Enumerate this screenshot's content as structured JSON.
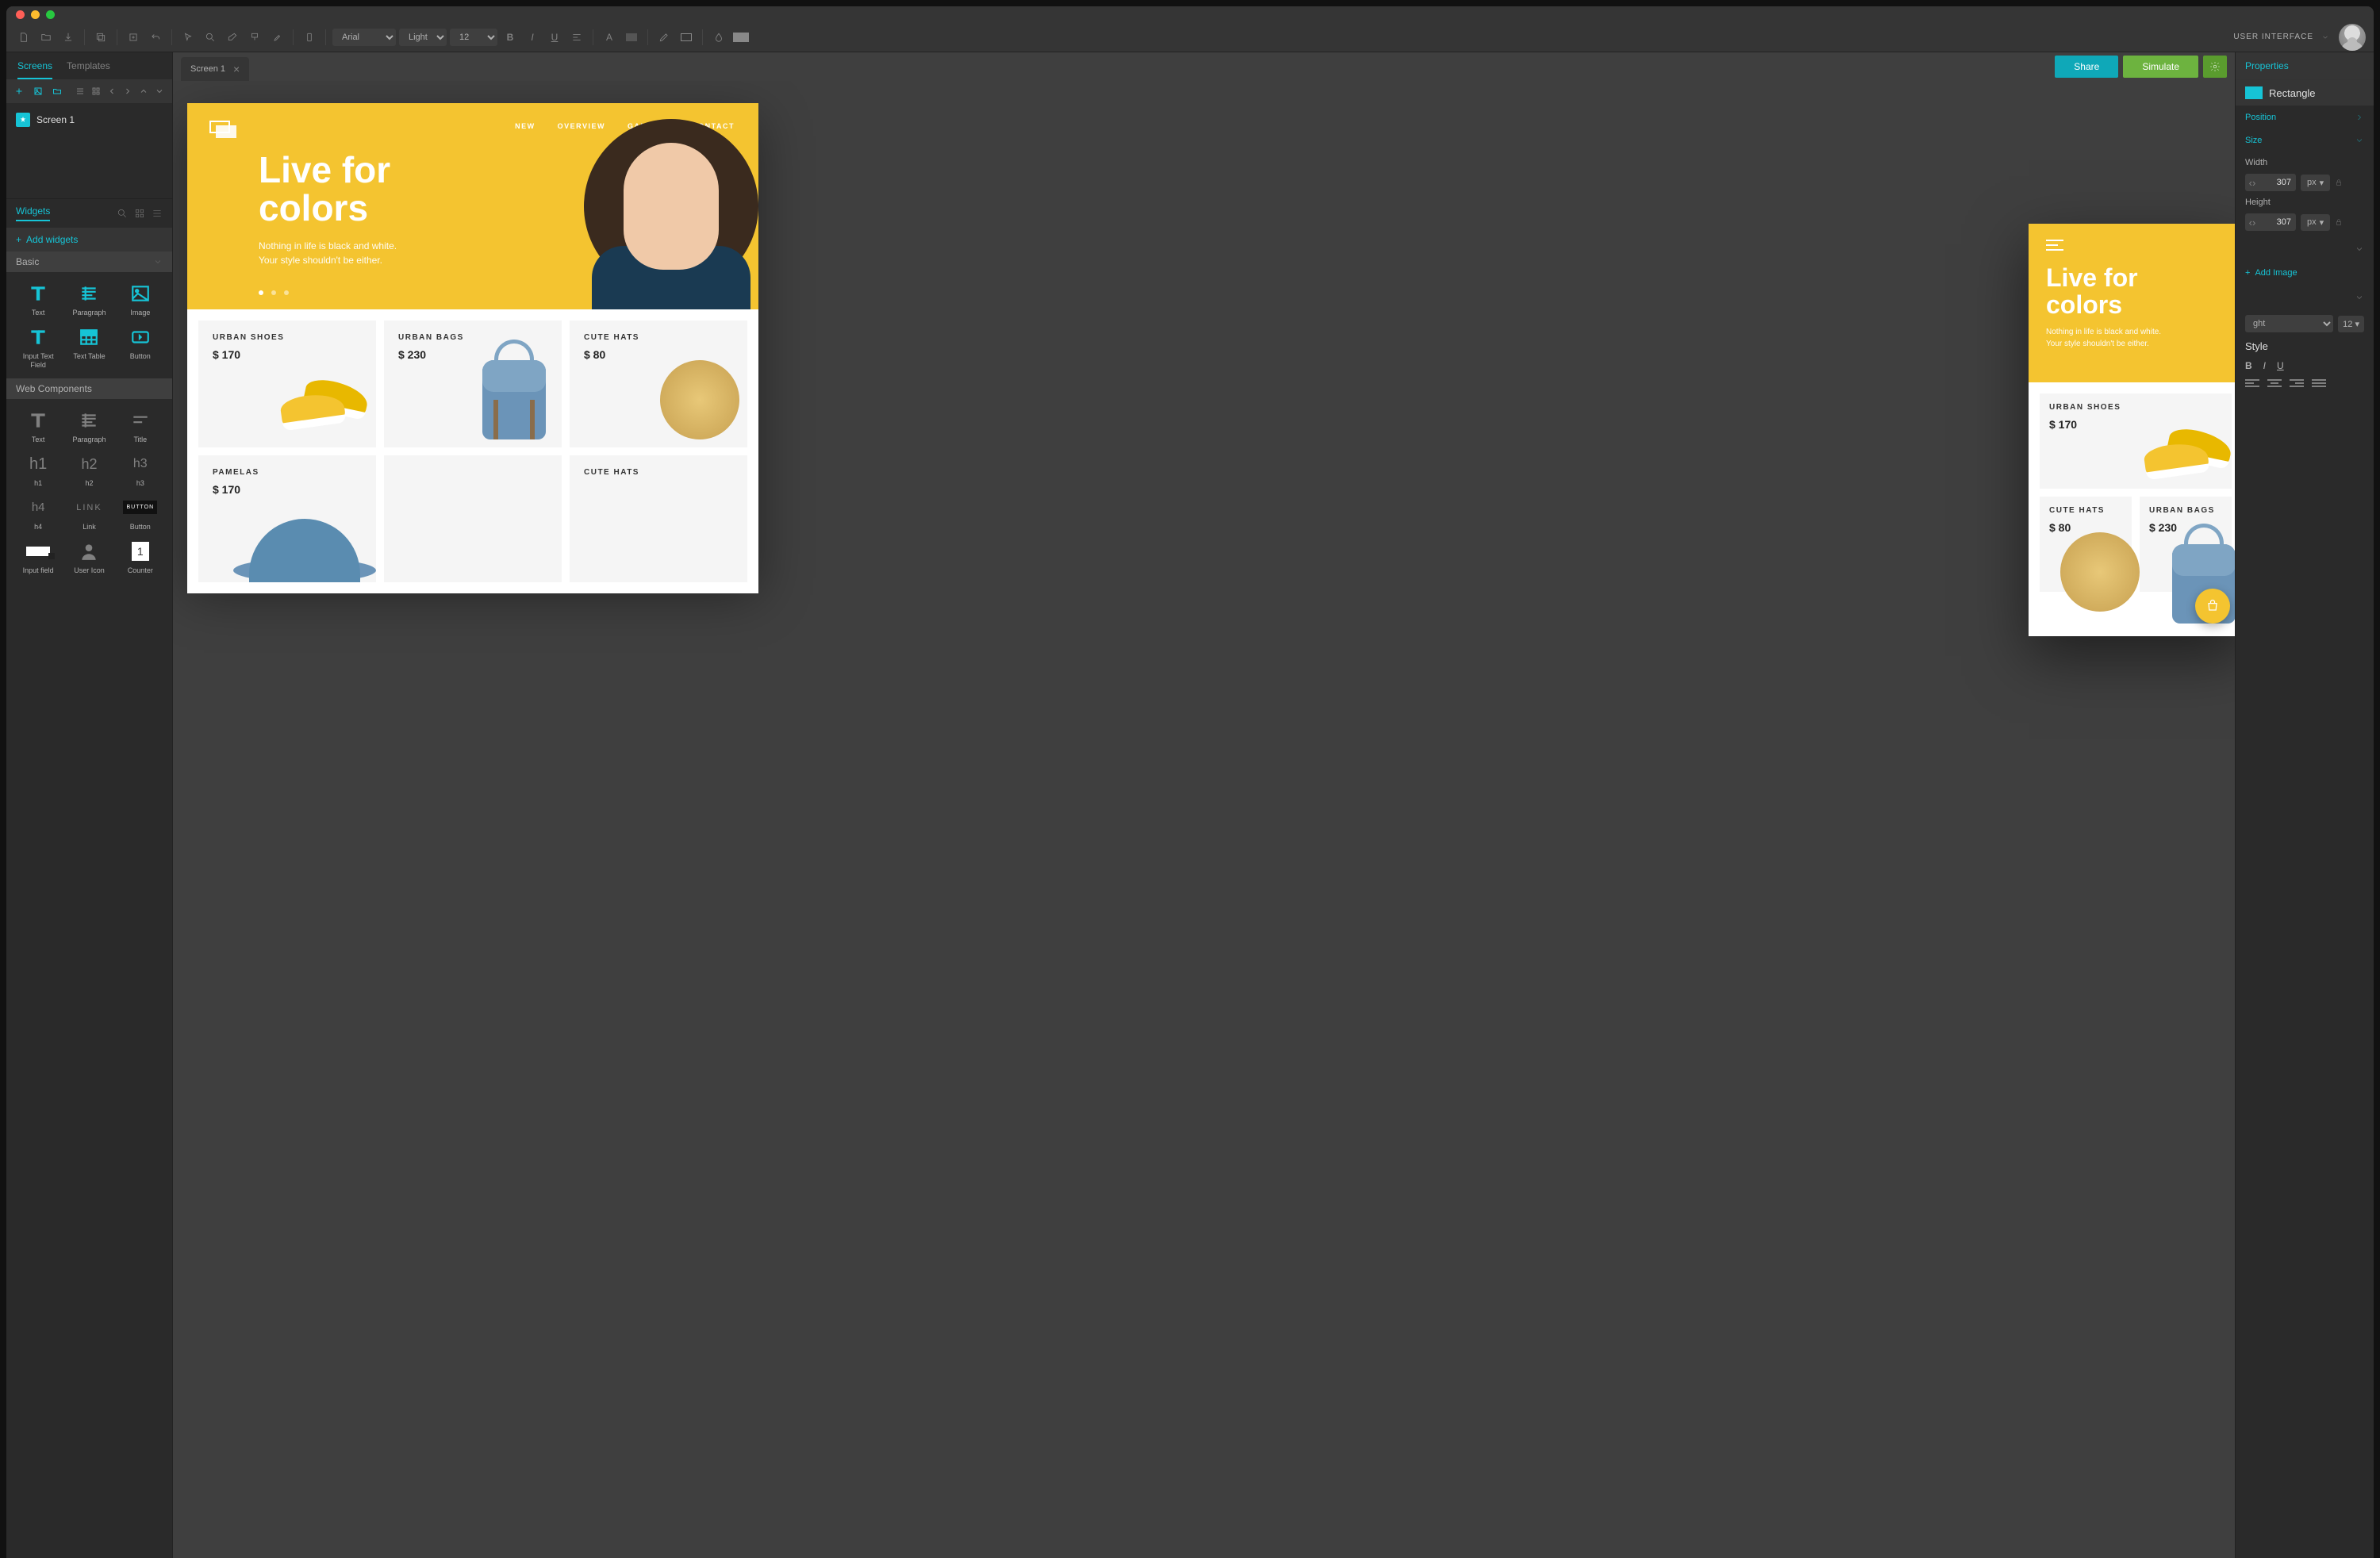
{
  "toolbar": {
    "font_family": "Arial",
    "font_weight": "Light",
    "font_size": "12",
    "user_role": "USER INTERFACE"
  },
  "left_panel": {
    "tabs": [
      "Screens",
      "Templates"
    ],
    "active_tab": 0,
    "screens": [
      {
        "name": "Screen 1"
      }
    ],
    "widgets_label": "Widgets",
    "add_widgets_label": "Add widgets",
    "categories": {
      "basic": {
        "label": "Basic",
        "items": [
          "Text",
          "Paragraph",
          "Image",
          "Input Text Field",
          "Text Table",
          "Button"
        ]
      },
      "web": {
        "label": "Web Components",
        "items": [
          "Text",
          "Paragraph",
          "Title",
          "h1",
          "h2",
          "h3",
          "h4",
          "Link",
          "Button",
          "Input field",
          "User Icon",
          "Counter"
        ]
      }
    }
  },
  "canvas": {
    "tabs": [
      {
        "label": "Screen 1"
      }
    ],
    "share_label": "Share",
    "simulate_label": "Simulate"
  },
  "site": {
    "nav": [
      "NEW",
      "OVERVIEW",
      "GALLERY",
      "CONTACT"
    ],
    "headline1": "Live for",
    "headline2": "colors",
    "sub1": "Nothing in life is black and white.",
    "sub2": "Your style shouldn't be either.",
    "products": [
      {
        "name": "URBAN SHOES",
        "price": "$ 170"
      },
      {
        "name": "URBAN BAGS",
        "price": "$ 230"
      },
      {
        "name": "CUTE HATS",
        "price": "$ 80"
      },
      {
        "name": "PAMELAS",
        "price": "$ 170"
      }
    ]
  },
  "mobile": {
    "products": [
      {
        "name": "URBAN SHOES",
        "price": "$ 170"
      },
      {
        "name": "CUTE HATS",
        "price": "$ 80"
      },
      {
        "name": "URBAN BAGS",
        "price": "$ 230"
      }
    ]
  },
  "right_panel": {
    "properties_label": "Properties",
    "shape_label": "Rectangle",
    "position_label": "Position",
    "size_label": "Size",
    "width_label": "Width",
    "height_label": "Height",
    "width_value": "307",
    "height_value": "307",
    "unit": "px",
    "add_image_label": "Add Image",
    "text_weight": "ght",
    "text_size": "12",
    "style_label": "Style",
    "link_placeholder": "LINK",
    "button_placeholder": "BUTTON"
  }
}
